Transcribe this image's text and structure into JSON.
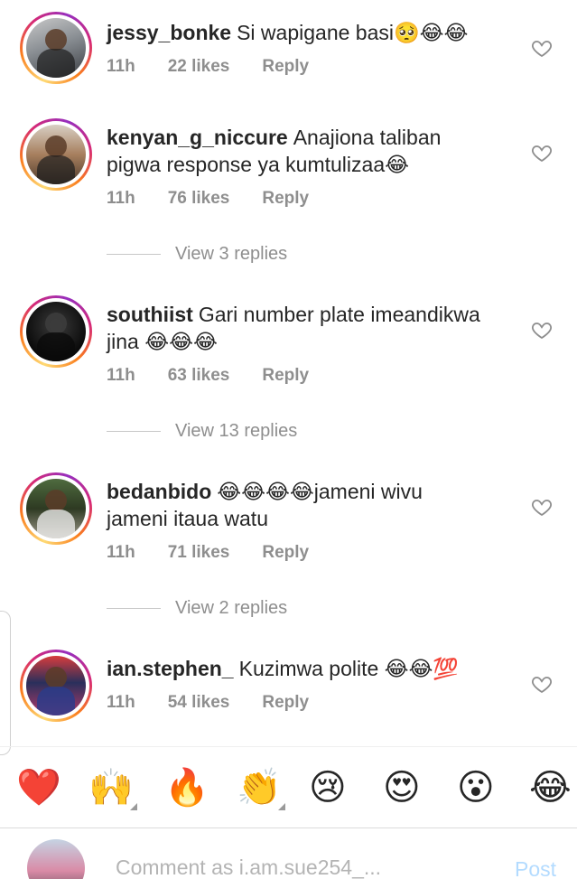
{
  "comments": [
    {
      "username": "jessy_bonke",
      "text": "Si wapigane basi🥺😂😂",
      "time": "11h",
      "likes": "22 likes",
      "reply": "Reply"
    },
    {
      "username": "kenyan_g_niccure",
      "text": "Anajiona taliban pigwa  response ya kumtulizaa😂",
      "time": "11h",
      "likes": "76 likes",
      "reply": "Reply"
    },
    {
      "username": "southiist",
      "text": "Gari number plate imeandikwa jina 😂😂😂",
      "time": "11h",
      "likes": "63 likes",
      "reply": "Reply"
    },
    {
      "username": "bedanbido",
      "text": "😂😂😂😂jameni wivu jameni itaua watu",
      "time": "11h",
      "likes": "71 likes",
      "reply": "Reply"
    },
    {
      "username": "ian.stephen_",
      "text": "Kuzimwa polite 😂😂💯",
      "time": "11h",
      "likes": "54 likes",
      "reply": "Reply"
    }
  ],
  "view_replies": [
    "View 3 replies",
    "View 13 replies",
    "View 2 replies"
  ],
  "emoji_bar": [
    "❤️",
    "🙌",
    "🔥",
    "👏",
    "😢",
    "😍",
    "😮",
    "😂"
  ],
  "composer": {
    "placeholder": "Comment as i.am.sue254_...",
    "post_label": "Post"
  },
  "colors": {
    "meta_gray": "#8e8e8e",
    "post_disabled": "#b3dbff",
    "text": "#262626"
  }
}
